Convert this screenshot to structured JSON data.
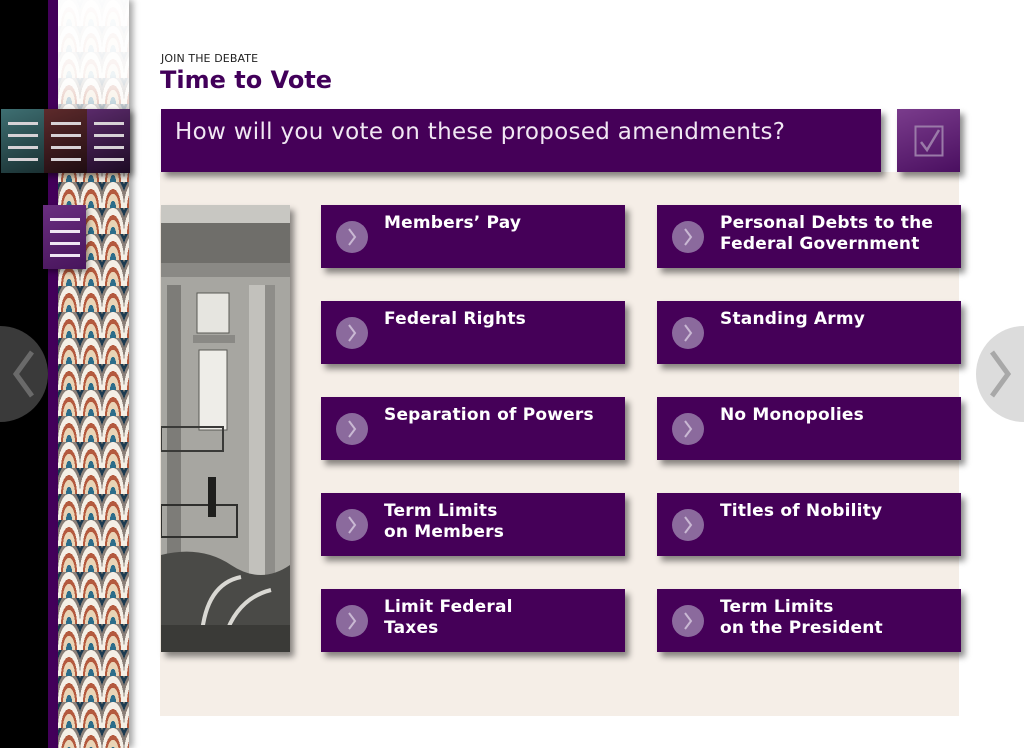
{
  "header": {
    "eyebrow": "JOIN THE DEBATE",
    "title": "Time to Vote"
  },
  "question": {
    "text": "How will you vote on these proposed amendments?",
    "submit_icon": "checkbox-check-icon"
  },
  "sidebar": {
    "menu_buttons": [
      {
        "icon": "menu-icon",
        "color": "#3e6f72"
      },
      {
        "icon": "menu-icon",
        "color": "#5d2a2b"
      },
      {
        "icon": "menu-icon",
        "color": "#5a2a6a"
      }
    ],
    "section_menu": {
      "icon": "menu-icon",
      "color": "#6a2e80"
    }
  },
  "navigation": {
    "prev_icon": "chevron-left-icon",
    "next_icon": "chevron-right-icon"
  },
  "illustration": {
    "alt": "Engraving of a legislative chamber interior with a speaker on a balcony"
  },
  "amendments": [
    {
      "label": "Members’ Pay"
    },
    {
      "label": "Personal Debts to the\nFederal Government"
    },
    {
      "label": "Federal Rights"
    },
    {
      "label": "Standing Army"
    },
    {
      "label": "Separation of Powers"
    },
    {
      "label": "No Monopolies"
    },
    {
      "label": "Term Limits\non Members"
    },
    {
      "label": "Titles of Nobility"
    },
    {
      "label": "Limit Federal\nTaxes"
    },
    {
      "label": "Term Limits\non the President"
    }
  ],
  "colors": {
    "brand_purple": "#450058",
    "title_purple": "#42005a",
    "panel_bg": "#f5eee7",
    "chevron_circle": "#8b6a9d"
  }
}
